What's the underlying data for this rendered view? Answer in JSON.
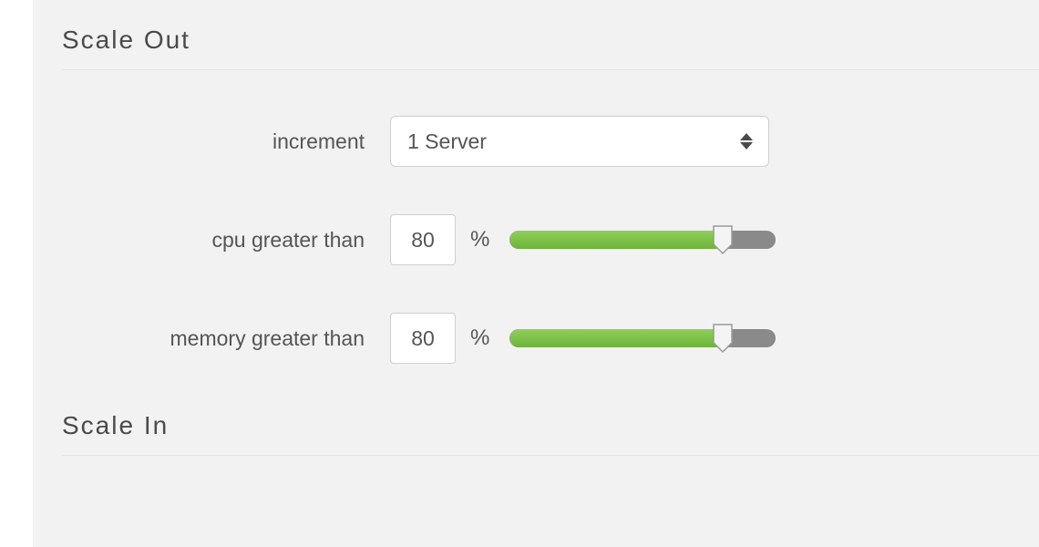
{
  "scaleOut": {
    "title": "Scale Out",
    "increment": {
      "label": "increment",
      "selected": "1 Server"
    },
    "cpu": {
      "label": "cpu greater than",
      "value": "80",
      "unit": "%",
      "percent": 80
    },
    "memory": {
      "label": "memory greater than",
      "value": "80",
      "unit": "%",
      "percent": 80
    }
  },
  "scaleIn": {
    "title": "Scale In"
  }
}
